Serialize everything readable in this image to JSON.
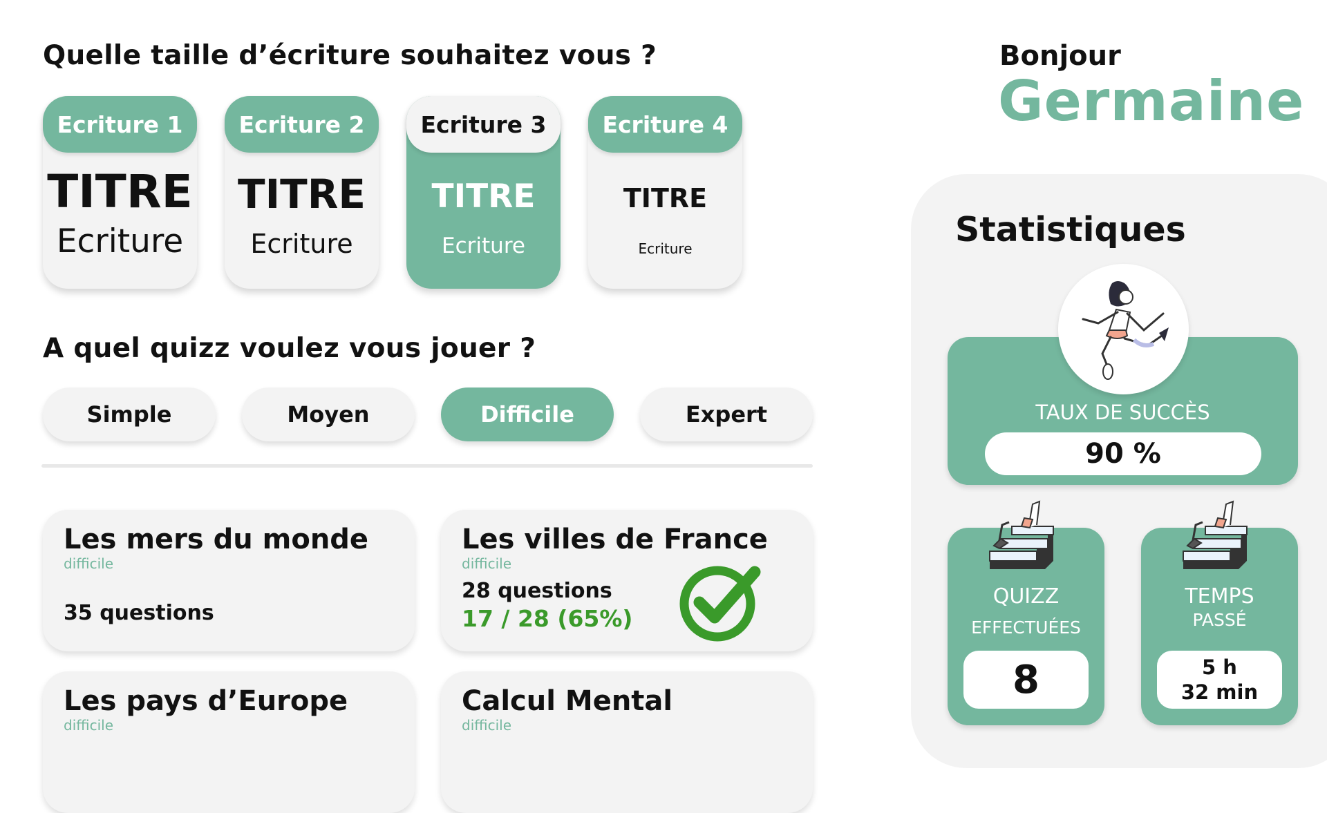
{
  "font_section": {
    "question": "Quelle taille d’écriture souhaitez vous ?",
    "options": [
      {
        "label": "Ecriture 1",
        "title": "TITRE",
        "subtitle": "Ecriture"
      },
      {
        "label": "Ecriture 2",
        "title": "TITRE",
        "subtitle": "Ecriture"
      },
      {
        "label": "Ecriture 3",
        "title": "TITRE",
        "subtitle": "Ecriture"
      },
      {
        "label": "Ecriture 4",
        "title": "TITRE",
        "subtitle": "Ecriture"
      }
    ],
    "selected": "Ecriture 3"
  },
  "quiz_section": {
    "question": "A quel quizz voulez vous jouer ?",
    "levels": [
      "Simple",
      "Moyen",
      "Difficile",
      "Expert"
    ],
    "selected_level": "Difficile"
  },
  "quizzes": [
    {
      "title": "Les mers du monde",
      "level": "difficile",
      "questions": "35 questions"
    },
    {
      "title": "Les villes de France",
      "level": "difficile",
      "questions": "28 questions",
      "score": "17 / 28 (65%)",
      "completed": true
    },
    {
      "title": "Les pays d’Europe",
      "level": "difficile"
    },
    {
      "title": "Calcul Mental",
      "level": "difficile"
    }
  ],
  "greeting": {
    "hello": "Bonjour",
    "name": "Germaine"
  },
  "stats": {
    "title": "Statistiques",
    "success_label": "TAUX DE SUCCÈS",
    "success_value": "90 %",
    "quizz_label_1": "QUIZZ",
    "quizz_label_2": "EFFECTUÉES",
    "quizz_value": "8",
    "time_label_1": "TEMPS",
    "time_label_2": "PASSÉ",
    "time_value_1": "5 h",
    "time_value_2": "32 min"
  },
  "colors": {
    "accent": "#74b79e",
    "success": "#3a9a2a",
    "card": "#f3f3f3"
  },
  "icons": [
    "runner-illustration",
    "stairs-illustration",
    "checkmark-icon"
  ]
}
